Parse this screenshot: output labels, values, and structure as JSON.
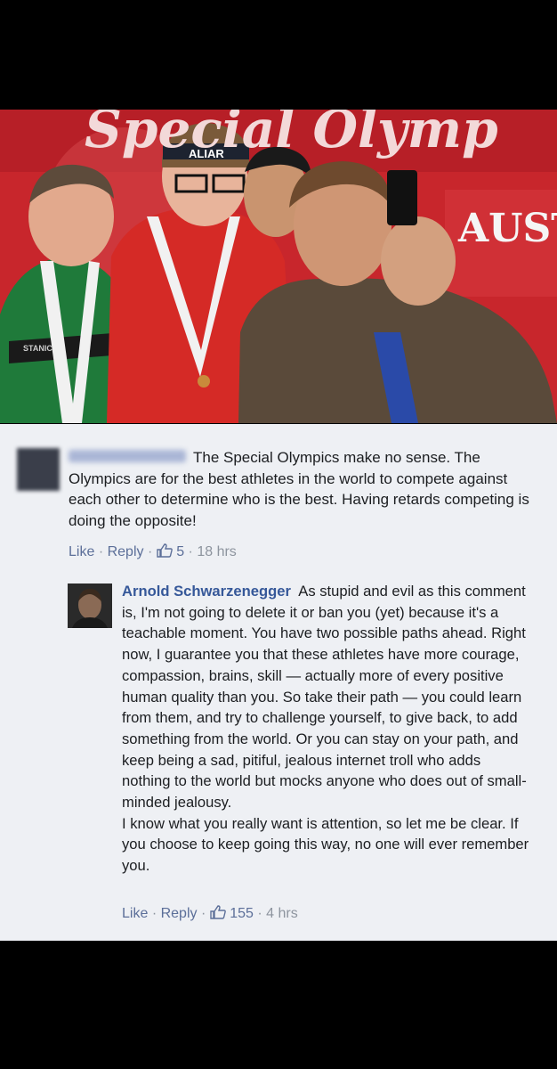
{
  "photo": {
    "banner_left": "Special Olymp",
    "banner_right": "AUST",
    "headband_text": "ALIAR",
    "jacket_text": "STANIC"
  },
  "comment1": {
    "text": "The Special Olympics make no sense. The Olympics are for the best athletes in the world to compete against each other to determine who is the best. Having retards competing is doing the opposite!",
    "like_label": "Like",
    "reply_label": "Reply",
    "reactions": "5",
    "time": "18 hrs",
    "sep": "·"
  },
  "reply": {
    "author": "Arnold Schwarzenegger",
    "text": "As stupid and evil as this comment is, I'm not going to delete it or ban you (yet) because it's a teachable moment. You have two possible paths ahead. Right now, I guarantee you that these athletes have more courage, compassion, brains, skill — actually more of every positive human quality than you. So take their path — you could learn from them, and try to challenge yourself, to give back, to add something from the world. Or you can stay on your path, and keep being a sad, pitiful, jealous internet troll who adds nothing to the world but mocks anyone who does out of small-minded jealousy.",
    "text2": "I know what you really want is attention, so let me be clear. If you choose to keep going this way, no one will ever remember you.",
    "like_label": "Like",
    "reply_label": "Reply",
    "reactions": "155",
    "time": "4 hrs",
    "sep": "·"
  },
  "colors": {
    "link": "#365899",
    "meta": "#5c6f99",
    "banner_red": "#c8262c",
    "card_bg": "#eef0f4"
  }
}
